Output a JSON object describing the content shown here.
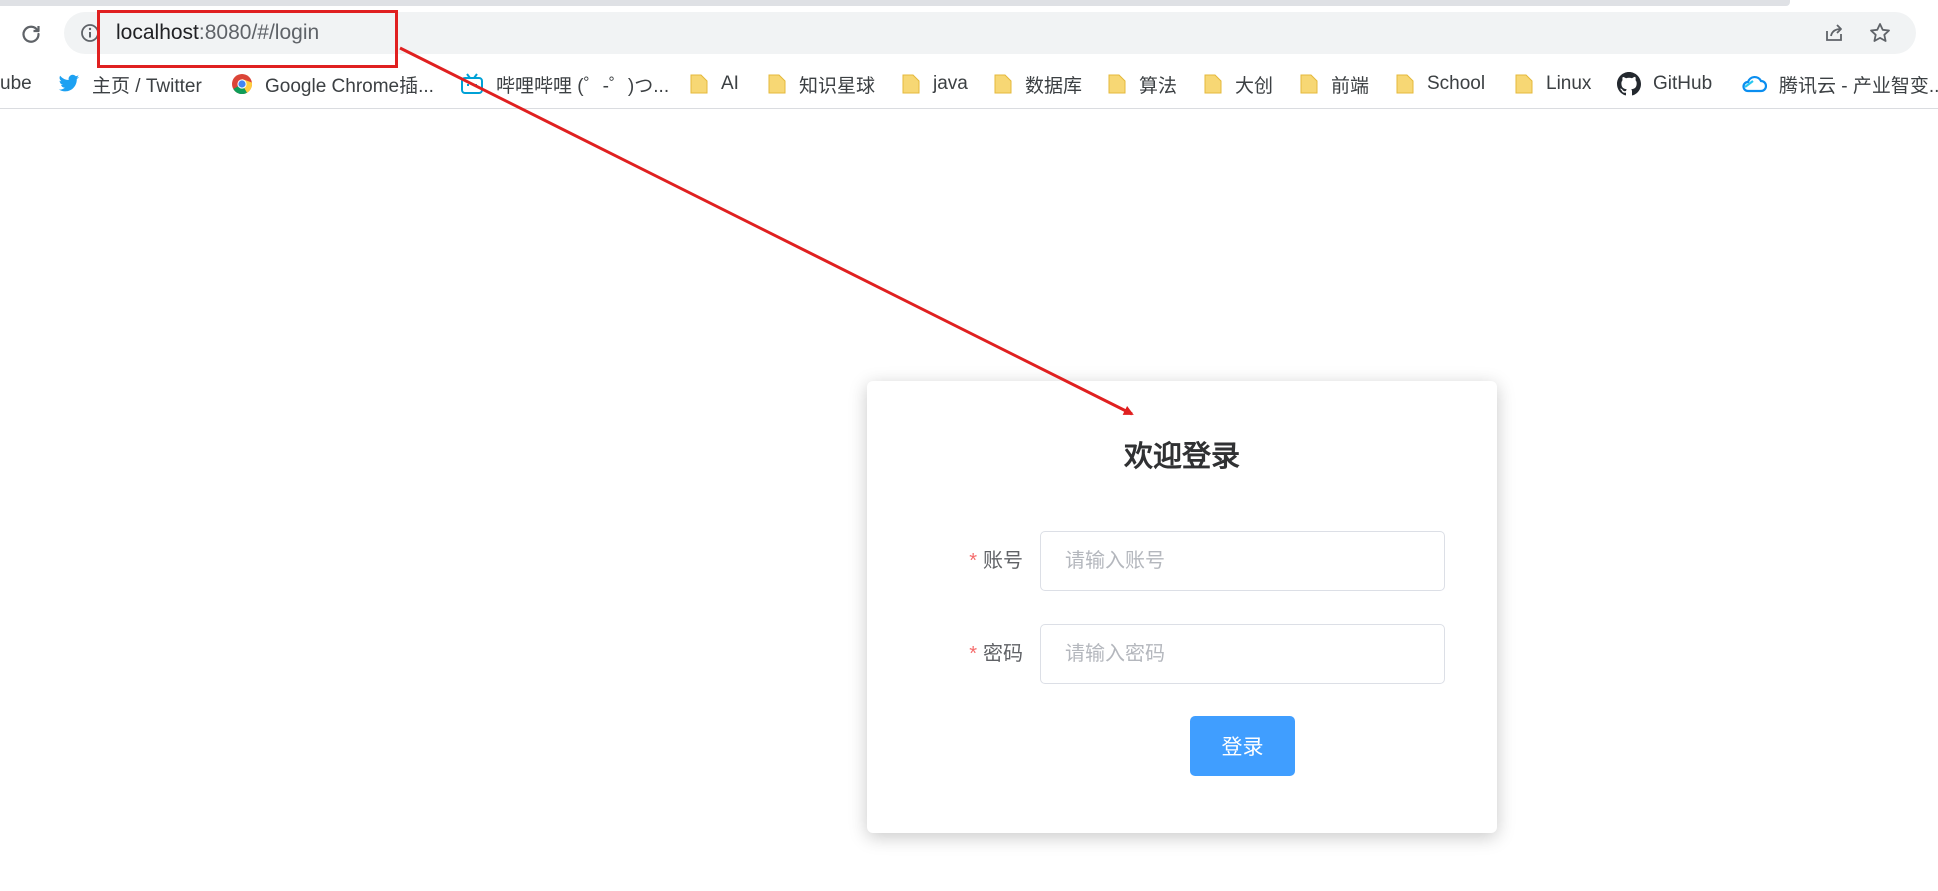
{
  "browser": {
    "url_host": "localhost",
    "url_rest": ":8080/#/login",
    "icons": [
      "reload-icon",
      "info-icon",
      "share-icon",
      "star-icon"
    ]
  },
  "bookmarks": [
    {
      "label": "ube",
      "icon": "none"
    },
    {
      "label": "主页 / Twitter",
      "icon": "twitter-icon"
    },
    {
      "label": "Google Chrome插...",
      "icon": "chrome-icon"
    },
    {
      "label": "哔哩哔哩 (゜-゜)つ...",
      "icon": "bilibili-icon"
    },
    {
      "label": "AI",
      "icon": "folder-icon"
    },
    {
      "label": "知识星球",
      "icon": "folder-icon"
    },
    {
      "label": "java",
      "icon": "folder-icon"
    },
    {
      "label": "数据库",
      "icon": "folder-icon"
    },
    {
      "label": "算法",
      "icon": "folder-icon"
    },
    {
      "label": "大创",
      "icon": "folder-icon"
    },
    {
      "label": "前端",
      "icon": "folder-icon"
    },
    {
      "label": "School",
      "icon": "folder-icon"
    },
    {
      "label": "Linux",
      "icon": "folder-icon"
    },
    {
      "label": "GitHub",
      "icon": "github-icon"
    },
    {
      "label": "腾讯云 - 产业智变...",
      "icon": "tencent-cloud-icon"
    }
  ],
  "login": {
    "title": "欢迎登录",
    "account_label": "账号",
    "account_placeholder": "请输入账号",
    "password_label": "密码",
    "password_placeholder": "请输入密码",
    "required_mark": "*",
    "submit_label": "登录"
  },
  "colors": {
    "primary": "#409eff",
    "required": "#f56c6c",
    "annotation": "#e02020"
  }
}
